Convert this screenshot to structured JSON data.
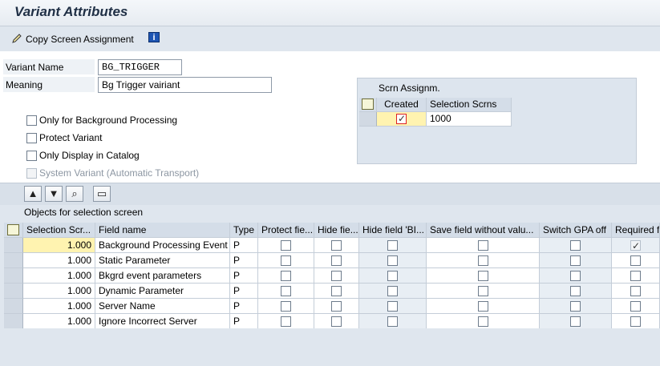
{
  "window": {
    "title": "Variant Attributes"
  },
  "toolbar": {
    "copy_screen_assignment": "Copy Screen Assignment",
    "info_icon": "i"
  },
  "form": {
    "variant_name_label": "Variant Name",
    "variant_name_value": "BG_TRIGGER",
    "meaning_label": "Meaning",
    "meaning_value": "Bg Trigger vairiant",
    "checkboxes": [
      {
        "label": "Only for Background Processing",
        "checked": false,
        "disabled": false
      },
      {
        "label": "Protect Variant",
        "checked": false,
        "disabled": false
      },
      {
        "label": "Only Display in Catalog",
        "checked": false,
        "disabled": false
      },
      {
        "label": "System Variant (Automatic Transport)",
        "checked": false,
        "disabled": true
      }
    ]
  },
  "screen_assignment": {
    "title": "Scrn Assignm.",
    "col_created": "Created",
    "col_selection_scrns": "Selection Scrns",
    "rows": [
      {
        "created": true,
        "selection_scrn": "1000"
      }
    ]
  },
  "grid": {
    "caption": "Objects for selection screen",
    "headers": [
      "Selection Scr...",
      "Field name",
      "Type",
      "Protect fie...",
      "Hide fie...",
      "Hide field 'BI...",
      "Save field without valu...",
      "Switch GPA off",
      "Required f"
    ],
    "rows": [
      {
        "sel": "1.000",
        "name": "Background Processing Event",
        "type": "P",
        "required": true
      },
      {
        "sel": "1.000",
        "name": "Static Parameter",
        "type": "P",
        "required": false
      },
      {
        "sel": "1.000",
        "name": "Bkgrd event parameters",
        "type": "P",
        "required": false
      },
      {
        "sel": "1.000",
        "name": "Dynamic Parameter",
        "type": "P",
        "required": false
      },
      {
        "sel": "1.000",
        "name": "Server Name",
        "type": "P",
        "required": false
      },
      {
        "sel": "1.000",
        "name": "Ignore Incorrect Server",
        "type": "P",
        "required": false
      }
    ]
  },
  "colors": {
    "background": "#dfe6ee",
    "header": "#d4dde8",
    "highlight": "#fff3b0",
    "title_text": "#1f2f45"
  }
}
